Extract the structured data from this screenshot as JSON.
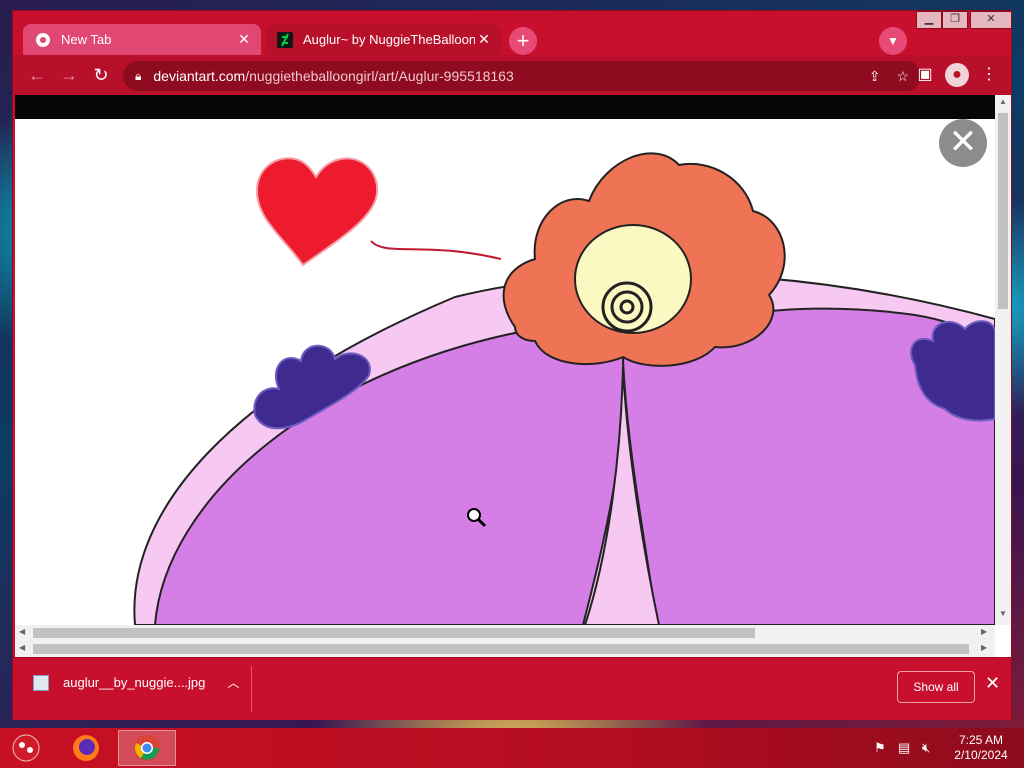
{
  "browser": {
    "tabs": [
      {
        "label": "New Tab",
        "active": false,
        "icon": "chrome-icon"
      },
      {
        "label": "Auglur~ by NuggieTheBalloonGi",
        "active": true,
        "icon": "deviantart-icon"
      }
    ],
    "address": {
      "host": "deviantart.com",
      "path": "/nuggietheballoongirl/art/Auglur-995518163"
    }
  },
  "download": {
    "file_name": "auglur__by_nuggie....jpg",
    "show_all_label": "Show all"
  },
  "taskbar": {
    "time": "7:25 AM",
    "date": "2/10/2024",
    "apps": [
      "firefox-icon",
      "chrome-icon"
    ]
  },
  "colors": {
    "accent": "#c8102e",
    "artwork_purple": "#d47ee6",
    "artwork_orange": "#ef7355",
    "heart": "#ee1b2e"
  }
}
